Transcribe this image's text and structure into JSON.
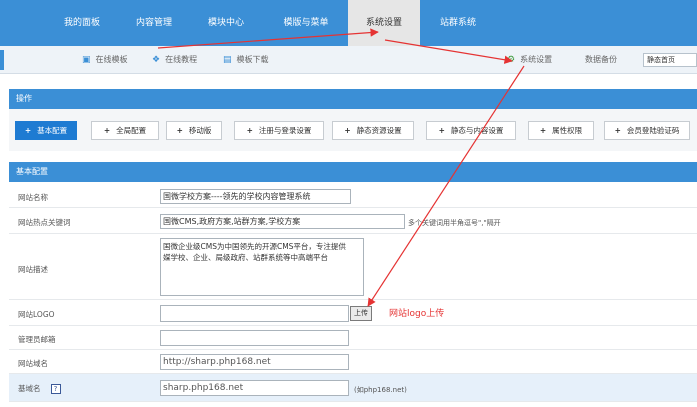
{
  "nav": {
    "items": [
      {
        "label": "我的面板",
        "active": false
      },
      {
        "label": "内容管理",
        "active": false
      },
      {
        "label": "模块中心",
        "active": false
      },
      {
        "label": "模版与菜单",
        "active": false
      },
      {
        "label": "系统设置",
        "active": true
      },
      {
        "label": "站群系统",
        "active": false
      }
    ]
  },
  "toolbar": {
    "links": [
      {
        "label": "在线模板",
        "icon": "monitor-icon"
      },
      {
        "label": "在线教程",
        "icon": "book-icon"
      },
      {
        "label": "模板下载",
        "icon": "download-icon"
      }
    ],
    "settings_label": "系统设置",
    "backup_label": "数据备份",
    "select_value": "静态首页"
  },
  "operations": {
    "title": "操作",
    "buttons": [
      {
        "label": "基本配置",
        "primary": true
      },
      {
        "label": "全局配置"
      },
      {
        "label": "移动版"
      },
      {
        "label": "注册与登录设置"
      },
      {
        "label": "静态资源设置"
      },
      {
        "label": "静态与内容设置"
      },
      {
        "label": "属性权限"
      },
      {
        "label": "会员登陆验证码"
      }
    ]
  },
  "basic": {
    "title": "基本配置",
    "site_name_label": "网站名称",
    "site_name_value": "国微学校方案----领先的学校内容管理系统",
    "keywords_label": "网站热点关键词",
    "keywords_value": "国微CMS,政府方案,站群方案,学校方案",
    "keywords_hint": "多个关键词用半角逗号\",\"隔开",
    "desc_label": "网站描述",
    "desc_value": "国微企业级CMS为中国领先的开源CMS平台，专注提供\n媒学校、企业、局级政府、站群系统等中高端平台",
    "logo_label": "网站LOGO",
    "logo_value": "",
    "upload_label": "上传",
    "admin_email_label": "管理员邮箱",
    "admin_email_value": "",
    "domain_label": "网站域名",
    "domain_value": "http://sharp.php168.net",
    "base_domain_label": "基域名",
    "help_mark": "?",
    "base_domain_value": "sharp.php168.net",
    "base_domain_hint": "(如php168.net)"
  },
  "annotation": {
    "text": "网站logo上传",
    "color": "#e53333"
  }
}
